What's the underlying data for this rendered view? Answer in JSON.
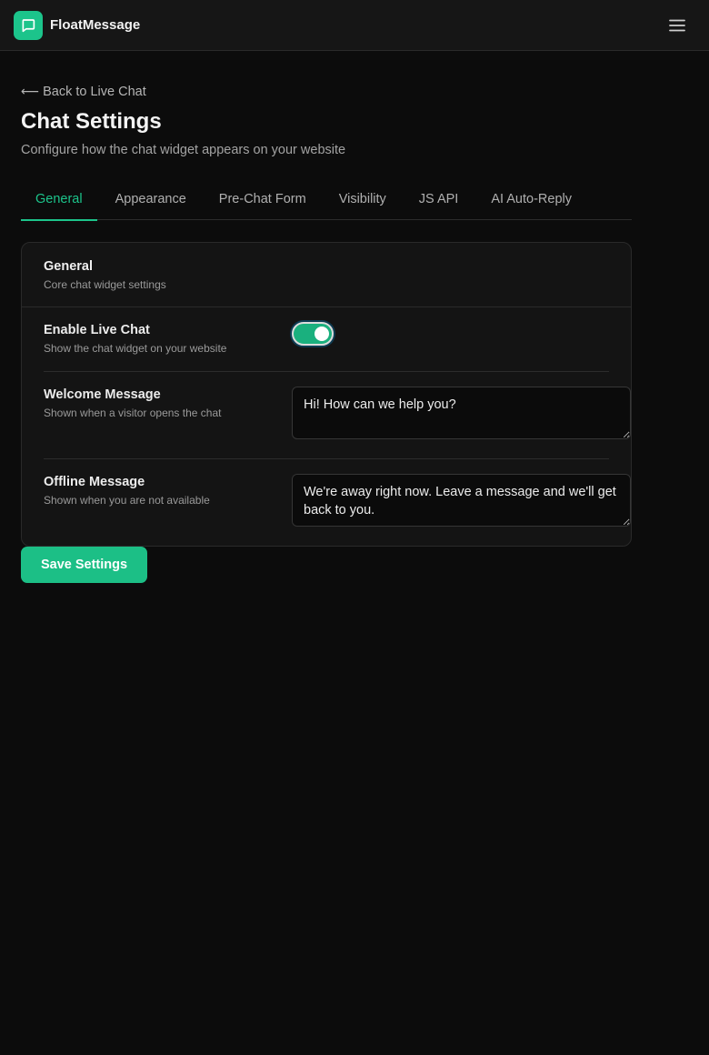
{
  "app": {
    "brand": "FloatMessage",
    "brand_color": "#1cc48b",
    "logo_icon": "chat-bubble-icon",
    "menu_icon": "hamburger-menu-icon"
  },
  "header": {
    "back_label": "Back to Live Chat",
    "title": "Chat Settings",
    "subtitle": "Configure how the chat widget appears on your website"
  },
  "tabs": [
    {
      "label": "General",
      "active": true
    },
    {
      "label": "Appearance",
      "active": false
    },
    {
      "label": "Pre-Chat Form",
      "active": false
    },
    {
      "label": "Visibility",
      "active": false
    },
    {
      "label": "JS API",
      "active": false
    },
    {
      "label": "AI Auto-Reply",
      "active": false
    }
  ],
  "card": {
    "title": "General",
    "subtitle": "Core chat widget settings",
    "settings": {
      "enable_live_chat": {
        "label": "Enable Live Chat",
        "description": "Show the chat widget on your website",
        "enabled": true
      },
      "welcome_message": {
        "label": "Welcome Message",
        "description": "Shown when a visitor opens the chat",
        "value": "Hi! How can we help you?"
      },
      "offline_message": {
        "label": "Offline Message",
        "description": "Shown when you are not available",
        "value": "We're away right now. Leave a message and we'll get back to you."
      }
    }
  },
  "actions": {
    "save_label": "Save Settings"
  }
}
